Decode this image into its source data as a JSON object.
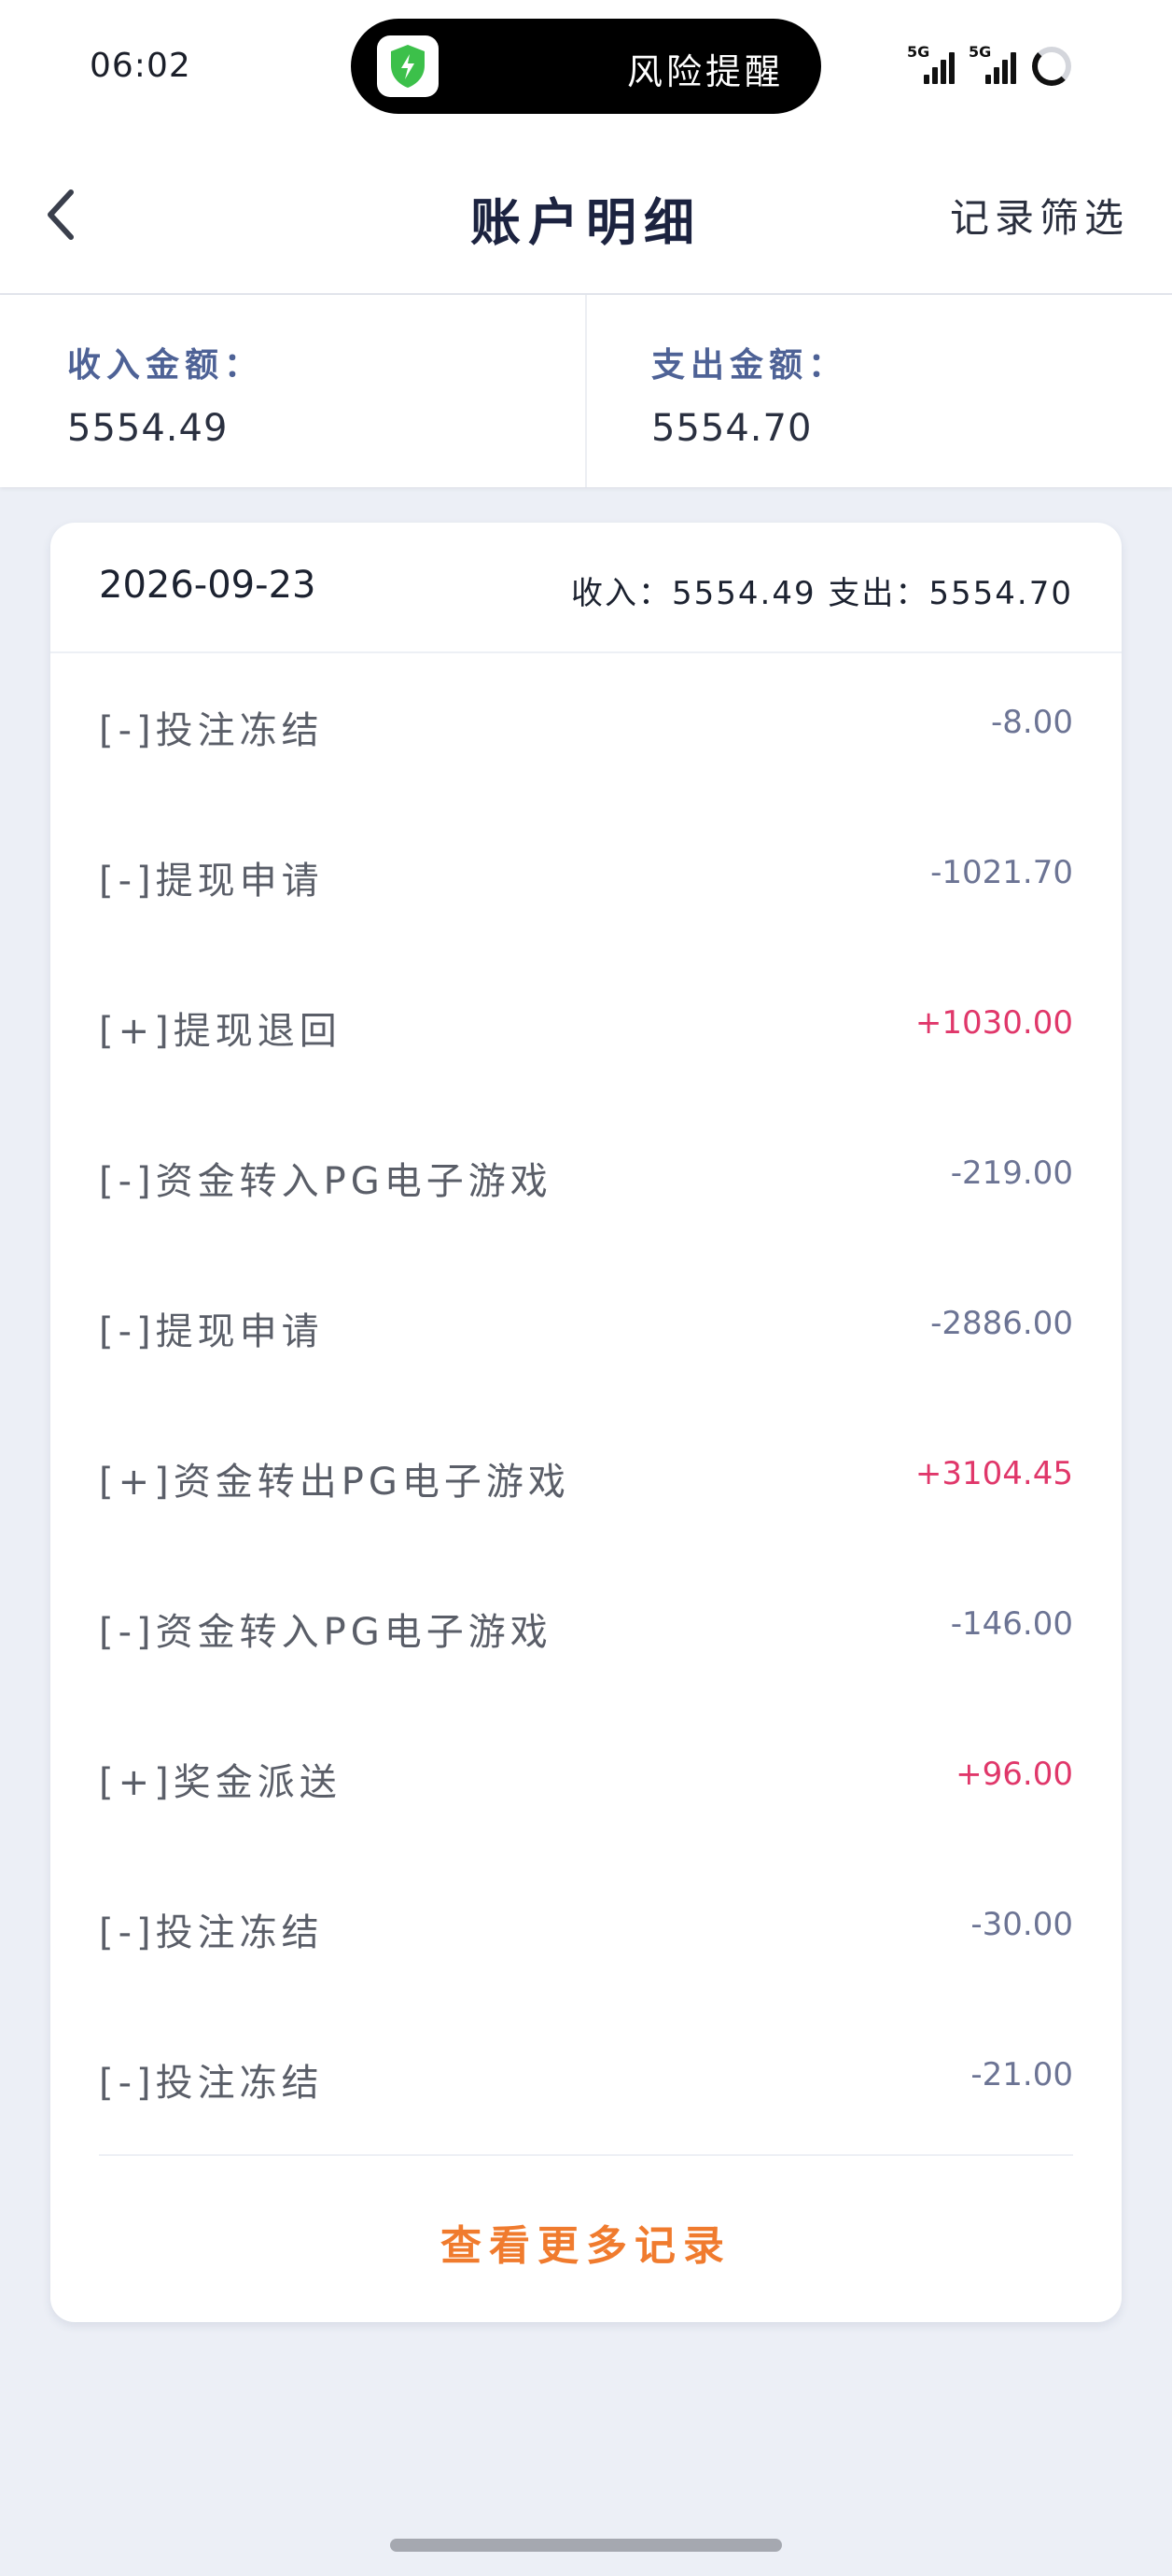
{
  "status_bar": {
    "time": "06:02",
    "island_text": "风险提醒",
    "signal_label_1": "5G",
    "signal_label_2": "5G",
    "shield_color": "#3cc04a"
  },
  "nav": {
    "title": "账户明细",
    "filter_label": "记录筛选",
    "back_icon": "chevron-left-icon"
  },
  "summary": {
    "income_label": "收入金额：",
    "income_value": "5554.49",
    "expense_label": "支出金额：",
    "expense_value": "5554.70"
  },
  "card": {
    "date": "2026-09-23",
    "totals": "收入：5554.49 支出：5554.70",
    "rows": [
      {
        "label": "[-]投注冻结",
        "amount": "-8.00",
        "sign": "neg"
      },
      {
        "label": "[-]提现申请",
        "amount": "-1021.70",
        "sign": "neg"
      },
      {
        "label": "[+]提现退回",
        "amount": "+1030.00",
        "sign": "pos"
      },
      {
        "label": "[-]资金转入PG电子游戏",
        "amount": "-219.00",
        "sign": "neg"
      },
      {
        "label": "[-]提现申请",
        "amount": "-2886.00",
        "sign": "neg"
      },
      {
        "label": "[+]资金转出PG电子游戏",
        "amount": "+3104.45",
        "sign": "pos"
      },
      {
        "label": "[-]资金转入PG电子游戏",
        "amount": "-146.00",
        "sign": "neg"
      },
      {
        "label": "[+]奖金派送",
        "amount": "+96.00",
        "sign": "pos"
      },
      {
        "label": "[-]投注冻结",
        "amount": "-30.00",
        "sign": "neg"
      },
      {
        "label": "[-]投注冻结",
        "amount": "-21.00",
        "sign": "neg"
      }
    ],
    "more_label": "查看更多记录"
  },
  "colors": {
    "negative": "#6c7494",
    "positive": "#e0376a",
    "more_link": "#f07b2e",
    "label_blue": "#4e6296"
  }
}
